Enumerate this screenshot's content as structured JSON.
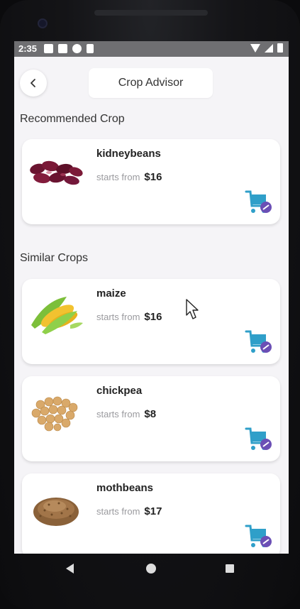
{
  "status_bar": {
    "time": "2:35"
  },
  "header": {
    "back_icon": "chevron-left-icon",
    "title": "Crop Advisor"
  },
  "recommended": {
    "section_title": "Recommended Crop",
    "item": {
      "name": "kidneybeans",
      "starts_label": "starts from",
      "price": "$16",
      "image": "kidney-beans-image"
    }
  },
  "similar": {
    "section_title": "Similar Crops",
    "items": [
      {
        "name": "maize",
        "starts_label": "starts from",
        "price": "$16",
        "image": "maize-image"
      },
      {
        "name": "chickpea",
        "starts_label": "starts from",
        "price": "$8",
        "image": "chickpea-image"
      },
      {
        "name": "mothbeans",
        "starts_label": "starts from",
        "price": "$17",
        "image": "mothbeans-image"
      }
    ]
  },
  "colors": {
    "cart_blue": "#2f9fc9",
    "cart_purple": "#6b4fb5",
    "background": "#f5f4f7"
  }
}
